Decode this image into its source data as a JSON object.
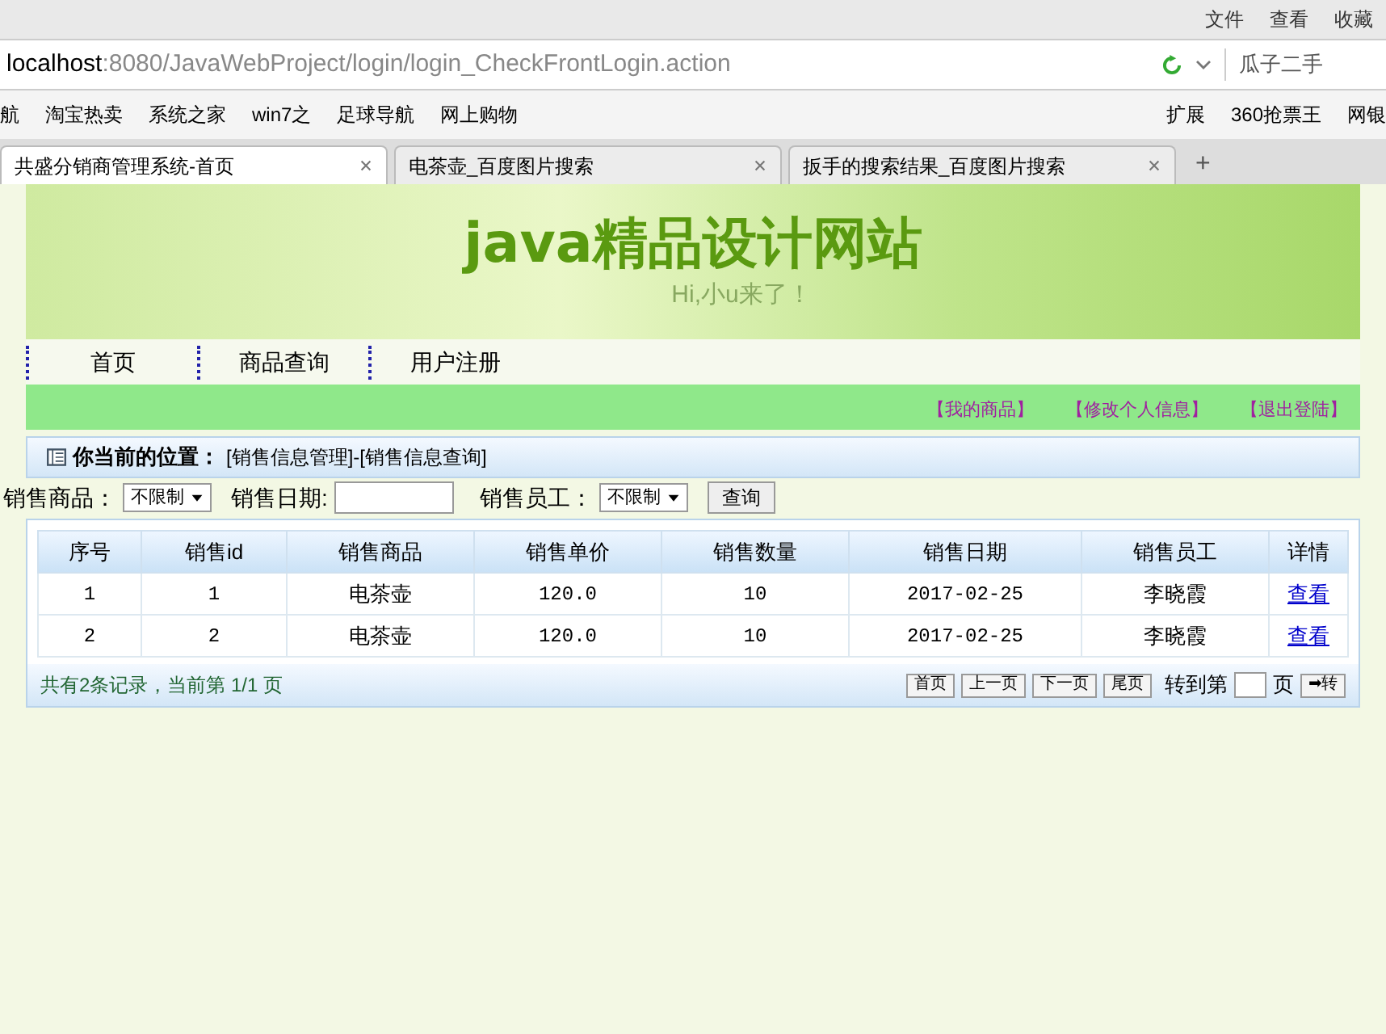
{
  "browser": {
    "menu": [
      "文件",
      "查看",
      "收藏"
    ],
    "address": {
      "host": "localhost",
      "path": ":8080/JavaWebProject/login/login_CheckFrontLogin.action"
    },
    "search_field": "瓜子二手",
    "bookmarks": [
      "航",
      "淘宝热卖",
      "系统之家",
      "win7之",
      "足球导航",
      "网上购物"
    ],
    "extras": [
      "扩展",
      "360抢票王",
      "网银"
    ],
    "tabs": [
      {
        "label": "共盛分销商管理系统-首页",
        "selected": true
      },
      {
        "label": "电茶壶_百度图片搜索",
        "selected": false
      },
      {
        "label": "扳手的搜索结果_百度图片搜索",
        "selected": false
      }
    ],
    "new_tab": "+"
  },
  "banner": {
    "title": "java精品设计网站",
    "greeting": "Hi,小u来了！"
  },
  "nav": [
    "首页",
    "商品查询",
    "用户注册"
  ],
  "user_links": [
    "【我的商品】",
    "【修改个人信息】",
    "【退出登陆】"
  ],
  "location": {
    "label": "你当前的位置：",
    "path": "[销售信息管理]-[销售信息查询]"
  },
  "filters": {
    "product_label": "销售商品：",
    "product_value": "不限制",
    "date_label": "销售日期:",
    "staff_label": "销售员工：",
    "staff_value": "不限制",
    "query_button": "查询"
  },
  "table": {
    "columns": [
      "序号",
      "销售id",
      "销售商品",
      "销售单价",
      "销售数量",
      "销售日期",
      "销售员工",
      "详情"
    ],
    "rows": [
      [
        "1",
        "1",
        "电茶壶",
        "120.0",
        "10",
        "2017-02-25",
        "李晓霞",
        "查看"
      ],
      [
        "2",
        "2",
        "电茶壶",
        "120.0",
        "10",
        "2017-02-25",
        "李晓霞",
        "查看"
      ]
    ]
  },
  "pager": {
    "summary": "共有2条记录，当前第 1/1 页",
    "buttons": [
      "首页",
      "上一页",
      "下一页",
      "尾页"
    ],
    "goto_label": "转到第",
    "page_label": "页",
    "go_button": "➡转"
  }
}
